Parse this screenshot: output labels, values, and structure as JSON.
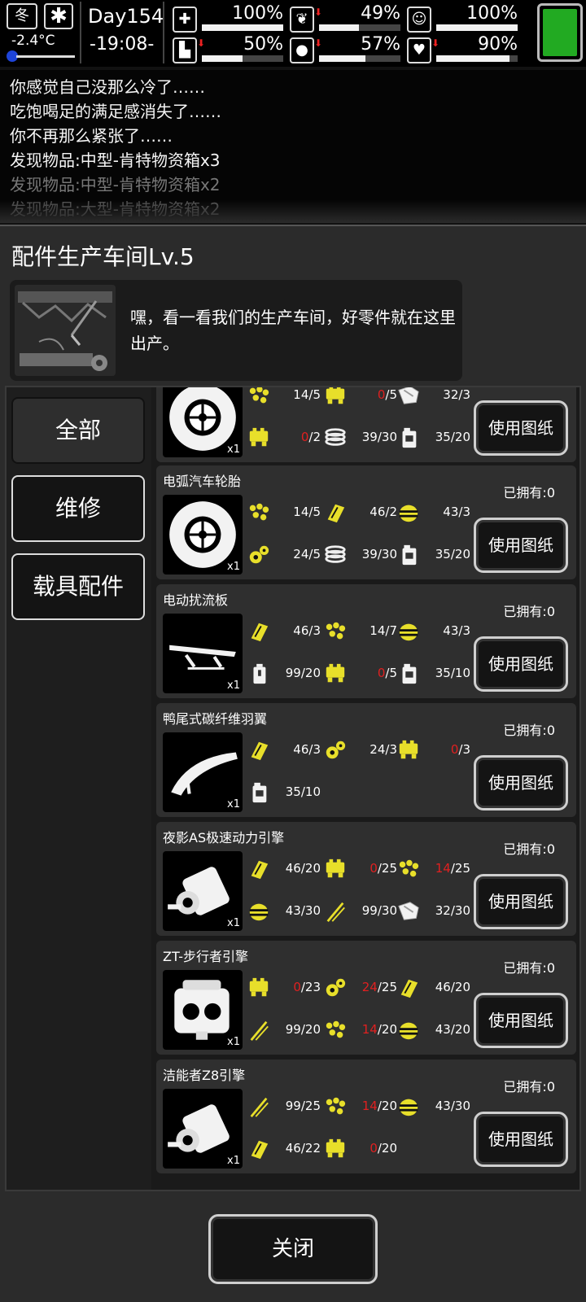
{
  "status": {
    "season": "冬",
    "temperature": "-2.4°C",
    "day": "Day154",
    "time": "-19:08-",
    "stats": [
      {
        "icon": "medkit-icon",
        "glyph": "✚",
        "value": "100%",
        "level": 1.0,
        "down": false
      },
      {
        "icon": "stomach-icon",
        "glyph": "❦",
        "value": "49%",
        "level": 0.49,
        "down": true
      },
      {
        "icon": "mood-icon",
        "glyph": "☺",
        "value": "100%",
        "level": 1.0,
        "down": false
      },
      {
        "icon": "boot-icon",
        "glyph": "▙",
        "value": "50%",
        "level": 0.5,
        "down": true
      },
      {
        "icon": "water-drop-icon",
        "glyph": "●",
        "value": "57%",
        "level": 0.57,
        "down": true
      },
      {
        "icon": "heart-icon",
        "glyph": "♥",
        "value": "90%",
        "level": 0.9,
        "down": true
      }
    ],
    "battery_level": 1.0
  },
  "log": [
    "你感觉自己没那么冷了……",
    "吃饱喝足的满足感消失了……",
    "你不再那么紧张了……",
    "发现物品:中型-肯特物资箱x3",
    "发现物品:中型-肯特物资箱x2",
    "发现物品:大型-肯特物资箱x2"
  ],
  "panel": {
    "title": "配件生产车间Lv.5",
    "npc_text": "嘿，看一看我们的生产车间，好零件就在这里出产。",
    "tabs": [
      "全部",
      "维修",
      "载具配件"
    ],
    "active_tab": 0,
    "use_label": "使用图纸",
    "close_label": "关闭",
    "qty_label": "x1"
  },
  "recipes": [
    {
      "name": "",
      "owned": "",
      "icon": "tire-icon",
      "reqs": [
        [
          "scrap-icon",
          "14",
          "5"
        ],
        [
          "engine-part-icon",
          "0",
          "5"
        ],
        [
          "cloth-icon",
          "32",
          "3"
        ],
        [
          "engine-part-icon",
          "0",
          "2"
        ],
        [
          "spring-icon",
          "39",
          "30"
        ],
        [
          "fuel-can-icon",
          "35",
          "20"
        ]
      ]
    },
    {
      "name": "电弧汽车轮胎",
      "owned": "已拥有:0",
      "icon": "tire-icon",
      "reqs": [
        [
          "scrap-icon",
          "14",
          "5"
        ],
        [
          "plate-icon",
          "46",
          "2"
        ],
        [
          "rubber-icon",
          "43",
          "3"
        ],
        [
          "gear-icon",
          "24",
          "5"
        ],
        [
          "spring-icon",
          "39",
          "30"
        ],
        [
          "fuel-can-icon",
          "35",
          "20"
        ]
      ]
    },
    {
      "name": "电动扰流板",
      "owned": "已拥有:0",
      "icon": "spoiler-icon",
      "reqs": [
        [
          "plate-icon",
          "46",
          "3"
        ],
        [
          "scrap-icon",
          "14",
          "7"
        ],
        [
          "rubber-icon",
          "43",
          "3"
        ],
        [
          "battery-icon",
          "99",
          "20"
        ],
        [
          "engine-part-icon",
          "0",
          "5"
        ],
        [
          "fuel-can-icon",
          "35",
          "10"
        ]
      ]
    },
    {
      "name": "鸭尾式碳纤维羽翼",
      "owned": "已拥有:0",
      "icon": "wing-icon",
      "reqs": [
        [
          "plate-icon",
          "46",
          "3"
        ],
        [
          "gear-icon",
          "24",
          "3"
        ],
        [
          "engine-part-icon",
          "0",
          "3"
        ],
        [
          "fuel-can-icon",
          "35",
          "10"
        ]
      ]
    },
    {
      "name": "夜影AS极速动力引擎",
      "owned": "已拥有:0",
      "icon": "motor-icon",
      "reqs": [
        [
          "plate-icon",
          "46",
          "20"
        ],
        [
          "engine-part-icon",
          "0",
          "25"
        ],
        [
          "scrap-icon",
          "14",
          "25"
        ],
        [
          "rubber-icon",
          "43",
          "30"
        ],
        [
          "wire-icon",
          "99",
          "30"
        ],
        [
          "cloth-icon",
          "32",
          "30"
        ]
      ]
    },
    {
      "name": "ZT-步行者引擎",
      "owned": "已拥有:0",
      "icon": "engine-block-icon",
      "reqs": [
        [
          "engine-part-icon",
          "0",
          "23"
        ],
        [
          "gear-icon",
          "24",
          "25"
        ],
        [
          "plate-icon",
          "46",
          "20"
        ],
        [
          "wire-icon",
          "99",
          "20"
        ],
        [
          "scrap-icon",
          "14",
          "20"
        ],
        [
          "rubber-icon",
          "43",
          "20"
        ]
      ]
    },
    {
      "name": "洁能者Z8引擎",
      "owned": "已拥有:0",
      "icon": "motor-icon",
      "reqs": [
        [
          "wire-icon",
          "99",
          "25"
        ],
        [
          "scrap-icon",
          "14",
          "20"
        ],
        [
          "rubber-icon",
          "43",
          "30"
        ],
        [
          "plate-icon",
          "46",
          "22"
        ],
        [
          "engine-part-icon",
          "0",
          "20"
        ]
      ]
    }
  ],
  "colors": {
    "yellow": "#e8df2a",
    "red": "#e02020",
    "green": "#22aa22",
    "blue": "#1e44d8"
  }
}
